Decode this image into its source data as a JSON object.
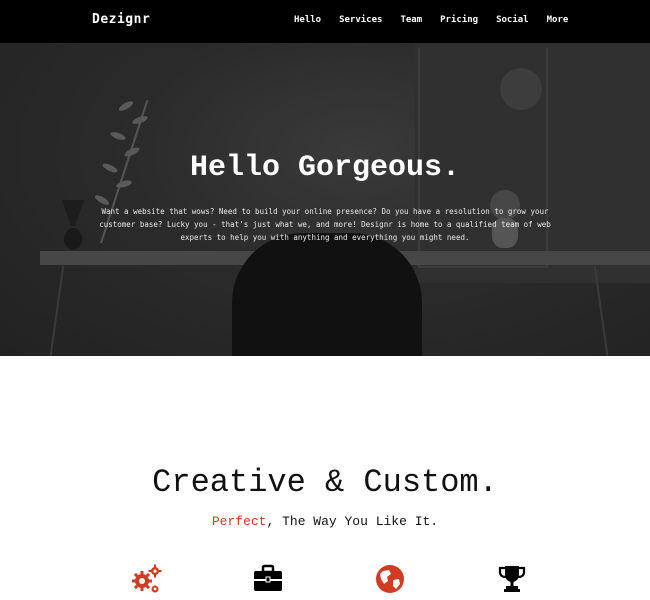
{
  "nav": {
    "brand": "Dezignr",
    "links": [
      "Hello",
      "Services",
      "Team",
      "Pricing",
      "Social",
      "More"
    ]
  },
  "hero": {
    "title": "Hello Gorgeous.",
    "text": "Want a website that wows? Need to build your online presence? Do you have a resolution to grow your customer base? Lucky you - that's just what we, and more! Designr is home to a qualified team of web experts to help you with anything and everything you might need."
  },
  "section": {
    "title": "Creative & Custom.",
    "subtitle_highlight": "Perfect",
    "subtitle_rest": ", The Way You Like It."
  },
  "icons": [
    {
      "name": "gears-icon",
      "color": "#d23a23"
    },
    {
      "name": "briefcase-icon",
      "color": "#000000"
    },
    {
      "name": "globe-icon",
      "color": "#d23a23"
    },
    {
      "name": "trophy-icon",
      "color": "#000000"
    }
  ],
  "colors": {
    "accent": "#d23a23",
    "nav_bg": "#000000"
  }
}
